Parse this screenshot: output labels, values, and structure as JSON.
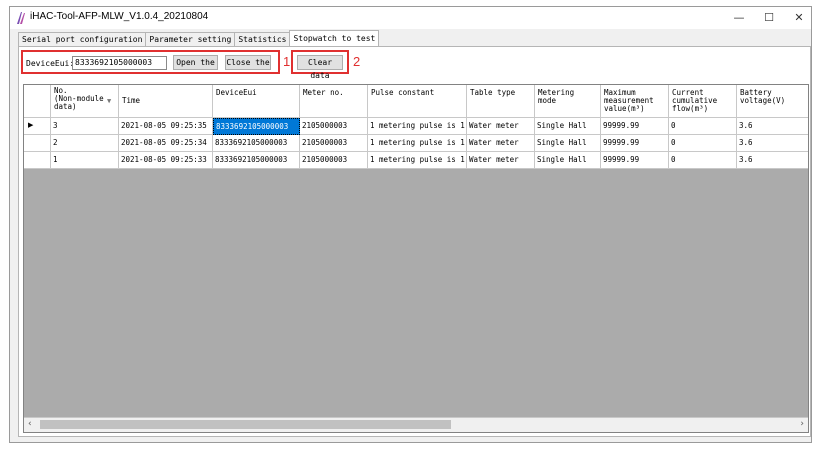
{
  "window": {
    "title": "iHAC-Tool-AFP-MLW_V1.0.4_20210804",
    "minimize": "—",
    "maximize": "☐",
    "close": "✕"
  },
  "tabs": [
    {
      "label": "Serial port configuration",
      "active": false
    },
    {
      "label": "Parameter setting",
      "active": false
    },
    {
      "label": "Statistics",
      "active": false
    },
    {
      "label": "Stopwatch to test",
      "active": true
    }
  ],
  "toolbar": {
    "deviceeui_label": "DeviceEui:",
    "deviceeui_value": "8333692105000003",
    "open_label": "Open the",
    "close_label": "Close the",
    "clear_label": "Clear data",
    "callout1": "1",
    "callout2": "2"
  },
  "grid": {
    "headers": [
      "No.\n(Non-module\ndata)",
      "Time",
      "DeviceEui",
      "Meter no.",
      "Pulse constant",
      "Table type",
      "Metering\nmode",
      "Maximum\nmeasurement\nvalue(m³)",
      "Current\ncumulative\nflow(m³)",
      "Battery\nvoltage(V)"
    ],
    "rows": [
      {
        "current": true,
        "cells": [
          "3",
          "2021-08-05 09:25:35",
          "8333692105000003",
          "2105000003",
          "1 metering pulse is 1...",
          "Water meter",
          "Single Hall",
          "99999.99",
          "0",
          "3.6"
        ]
      },
      {
        "current": false,
        "cells": [
          "2",
          "2021-08-05 09:25:34",
          "8333692105000003",
          "2105000003",
          "1 metering pulse is 1...",
          "Water meter",
          "Single Hall",
          "99999.99",
          "0",
          "3.6"
        ]
      },
      {
        "current": false,
        "cells": [
          "1",
          "2021-08-05 09:25:33",
          "8333692105000003",
          "2105000003",
          "1 metering pulse is 1...",
          "Water meter",
          "Single Hall",
          "99999.99",
          "0",
          "3.6"
        ]
      }
    ],
    "current_row_marker": "▶",
    "sort_icon": "▼",
    "scroll_left": "‹",
    "scroll_right": "›"
  },
  "colors": {
    "callout": "#e03030",
    "selection": "#0078d7",
    "grid_background": "#ababab"
  }
}
